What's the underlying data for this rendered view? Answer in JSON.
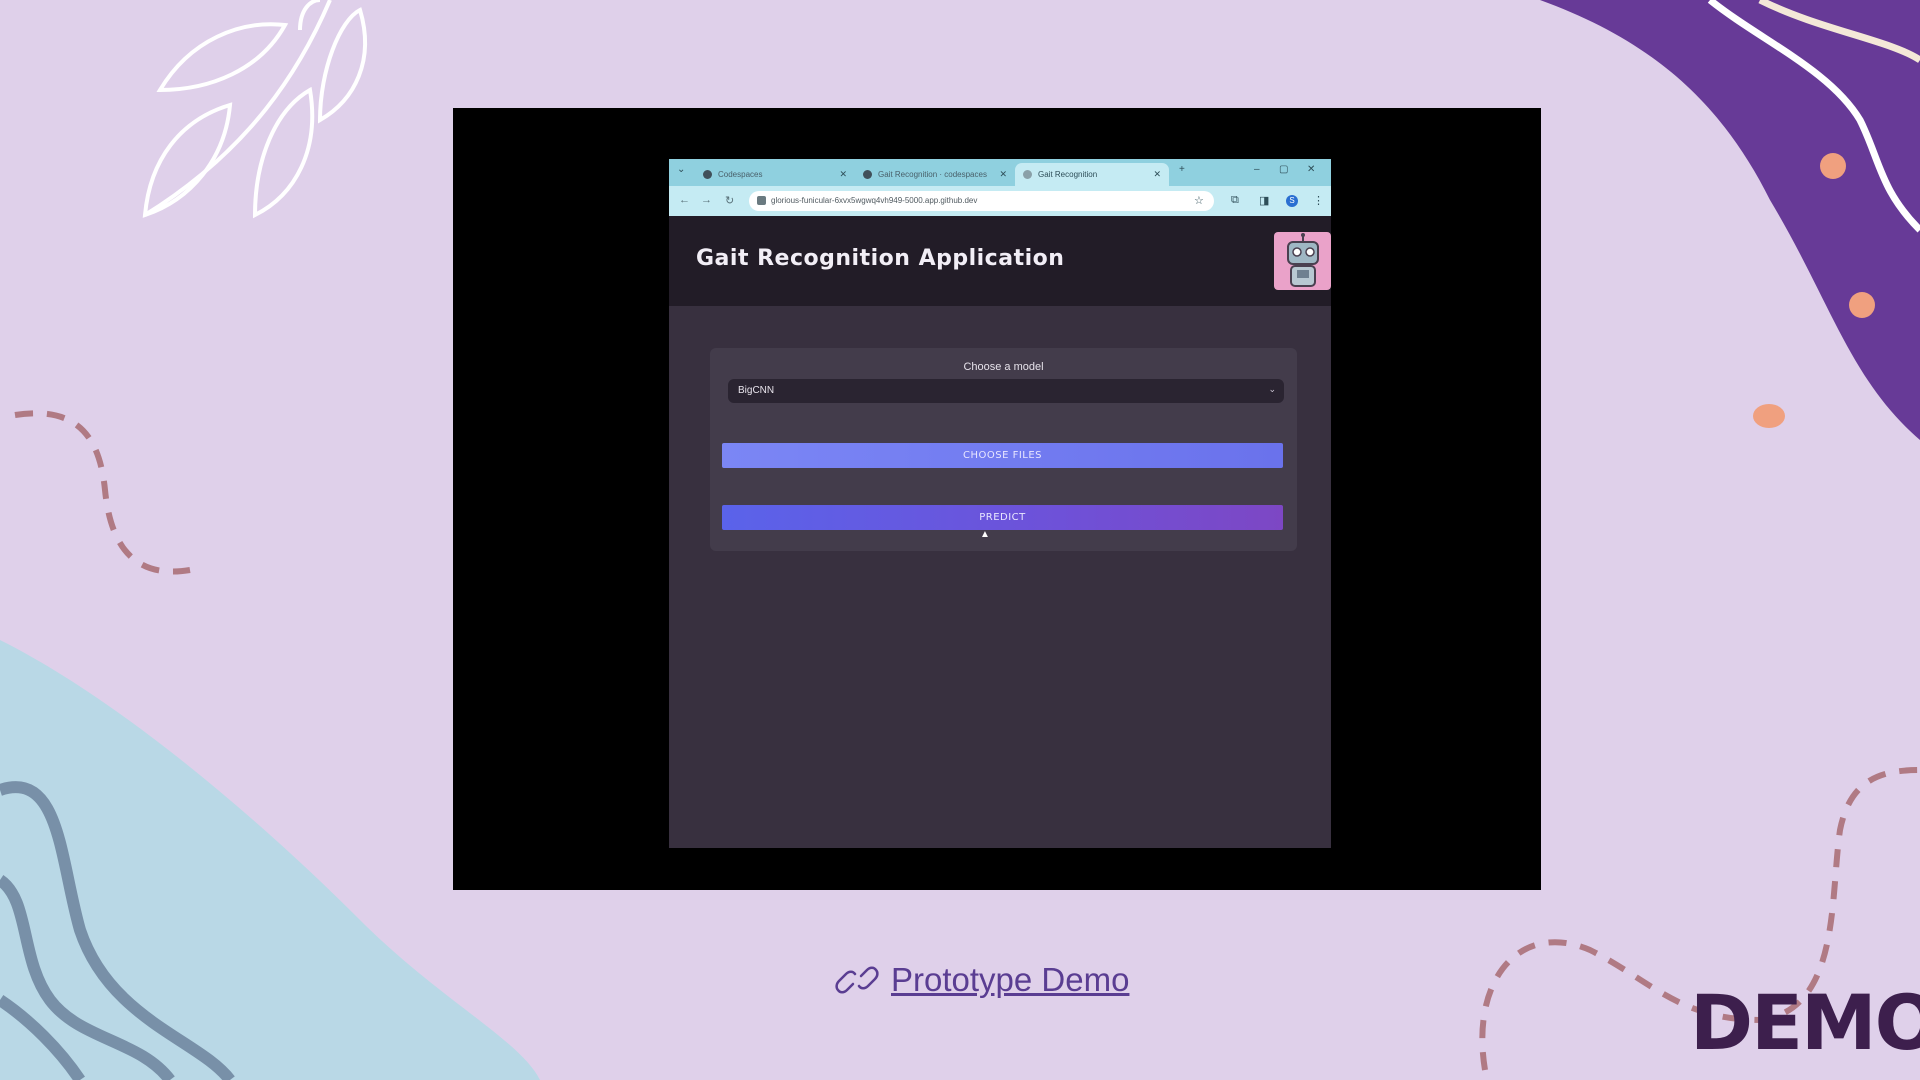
{
  "browser": {
    "tabs": [
      {
        "label": "Codespaces",
        "active": false
      },
      {
        "label": "Gait Recognition · codespaces",
        "active": false
      },
      {
        "label": "Gait Recognition",
        "active": true
      }
    ],
    "url": "glorious-funicular-6xvx5wgwq4vh949-5000.app.github.dev",
    "profile_initial": "S"
  },
  "app": {
    "title": "Gait Recognition Application",
    "model_label": "Choose a model",
    "selected_model": "BigCNN",
    "choose_files_label": "CHOOSE FILES",
    "predict_label": "PREDICT"
  },
  "slide": {
    "link_text": "Prototype Demo",
    "badge_text": "DEMO"
  },
  "colors": {
    "background": "#dfd0ea",
    "purple_blob": "#673a97",
    "link": "#5a3d92",
    "badge": "#3d1f4d"
  },
  "icons": [
    "link-icon",
    "robot-logo",
    "chevron-down-icon",
    "star-icon",
    "extensions-icon"
  ]
}
